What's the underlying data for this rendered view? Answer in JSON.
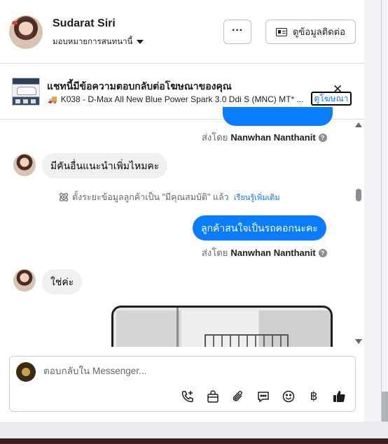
{
  "header": {
    "name": "Sudarat Siri",
    "assign_label": "มอบหมายการสนทนานี้",
    "more_label": "···",
    "contact_label": "ดูข้อมูลติดต่อ"
  },
  "ad": {
    "title": "แชทนี้มีข้อความตอบกลับต่อโฆษณาของคุณ",
    "line": "K038 - D-Max All New Blue Power Spark 3.0 Ddi S (MNC) MT* ...",
    "link": "ดูโฆษณา",
    "close": "✕"
  },
  "messages": {
    "sent_by_1_prefix": "ส่งโดย",
    "sent_by_1_name": "Nanwhan Nanthanit",
    "in_1": "มีคันอื่นแนะนำเพิ่มไหมคะ",
    "system_note": "ตั้งระยะข้อมูลลูกค้าเป็น \"มีคุณสมบัติ\" แล้ว",
    "system_link": "เรียนรู้เพิ่มเติม",
    "out_2": "ลูกค้าสนใจเป็นรถคอกนะคะ",
    "sent_by_2_prefix": "ส่งโดย",
    "sent_by_2_name": "Nanwhan Nanthanit",
    "in_2": "ใช่ค่ะ"
  },
  "composer": {
    "placeholder": "ตอบกลับใน Messenger...",
    "tools": [
      "phone-plus-icon",
      "shopping-bag-icon",
      "paperclip-icon",
      "chat-bubble-icon",
      "emoji-icon",
      "baht-icon",
      "thumbs-up-icon"
    ]
  },
  "colors": {
    "accent": "#0a7cff",
    "link": "#1877f2"
  }
}
